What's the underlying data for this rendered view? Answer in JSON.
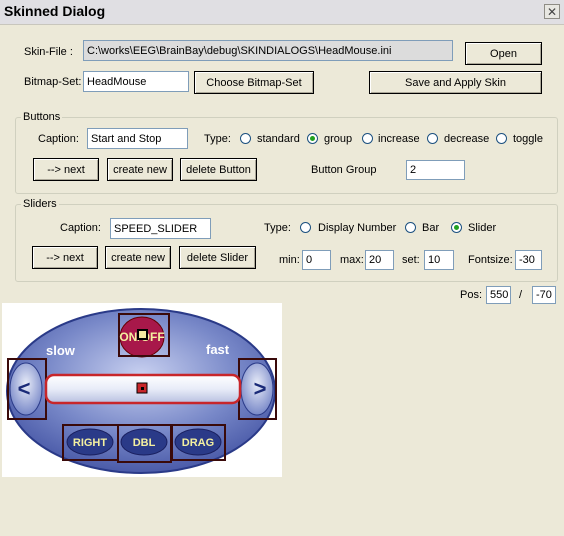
{
  "window": {
    "title": "Skinned Dialog",
    "close_glyph": "✕"
  },
  "skin_file": {
    "label": "Skin-File :",
    "value": "C:\\works\\EEG\\BrainBay\\debug\\SKINDIALOGS\\HeadMouse.ini",
    "open_label": "Open"
  },
  "bitmap_set": {
    "label": "Bitmap-Set:",
    "value": "HeadMouse",
    "choose_label": "Choose Bitmap-Set",
    "save_apply_label": "Save and Apply Skin"
  },
  "buttons_group": {
    "legend": "Buttons",
    "caption_label": "Caption:",
    "caption_value": "Start and Stop",
    "type_label": "Type:",
    "types": [
      "standard",
      "group",
      "increase",
      "decrease",
      "toggle"
    ],
    "selected_type": "group",
    "next_label": "--> next",
    "create_label": "create new",
    "delete_label": "delete Button",
    "group_label": "Button Group",
    "group_value": "2"
  },
  "sliders_group": {
    "legend": "Sliders",
    "caption_label": "Caption:",
    "caption_value": "SPEED_SLIDER",
    "type_label": "Type:",
    "types": [
      "Display Number",
      "Bar",
      "Slider"
    ],
    "selected_type": "Slider",
    "next_label": "--> next",
    "create_label": "create new",
    "delete_label": "delete Slider",
    "min_label": "min:",
    "min_value": "0",
    "max_label": "max:",
    "max_value": "20",
    "set_label": "set:",
    "set_value": "10",
    "fontsize_label": "Fontsize:",
    "fontsize_value": "-30"
  },
  "pos": {
    "label": "Pos:",
    "x": "550",
    "sep": "/",
    "y": "-70"
  },
  "skin_preview": {
    "onoff_label": "ON/OFF",
    "slow_label": "slow",
    "fast_label": "fast",
    "left_arrow": "<",
    "right_arrow": ">",
    "right_btn": "RIGHT",
    "dbl_btn": "DBL",
    "drag_btn": "DRAG",
    "colors": {
      "oval": "#4a5aa8",
      "inner": "#98a8d8",
      "highlight": "#c8262a",
      "frame": "#3a0a0a",
      "button_fill": "#2a3a88",
      "button_text": "#f4f0a0"
    }
  }
}
